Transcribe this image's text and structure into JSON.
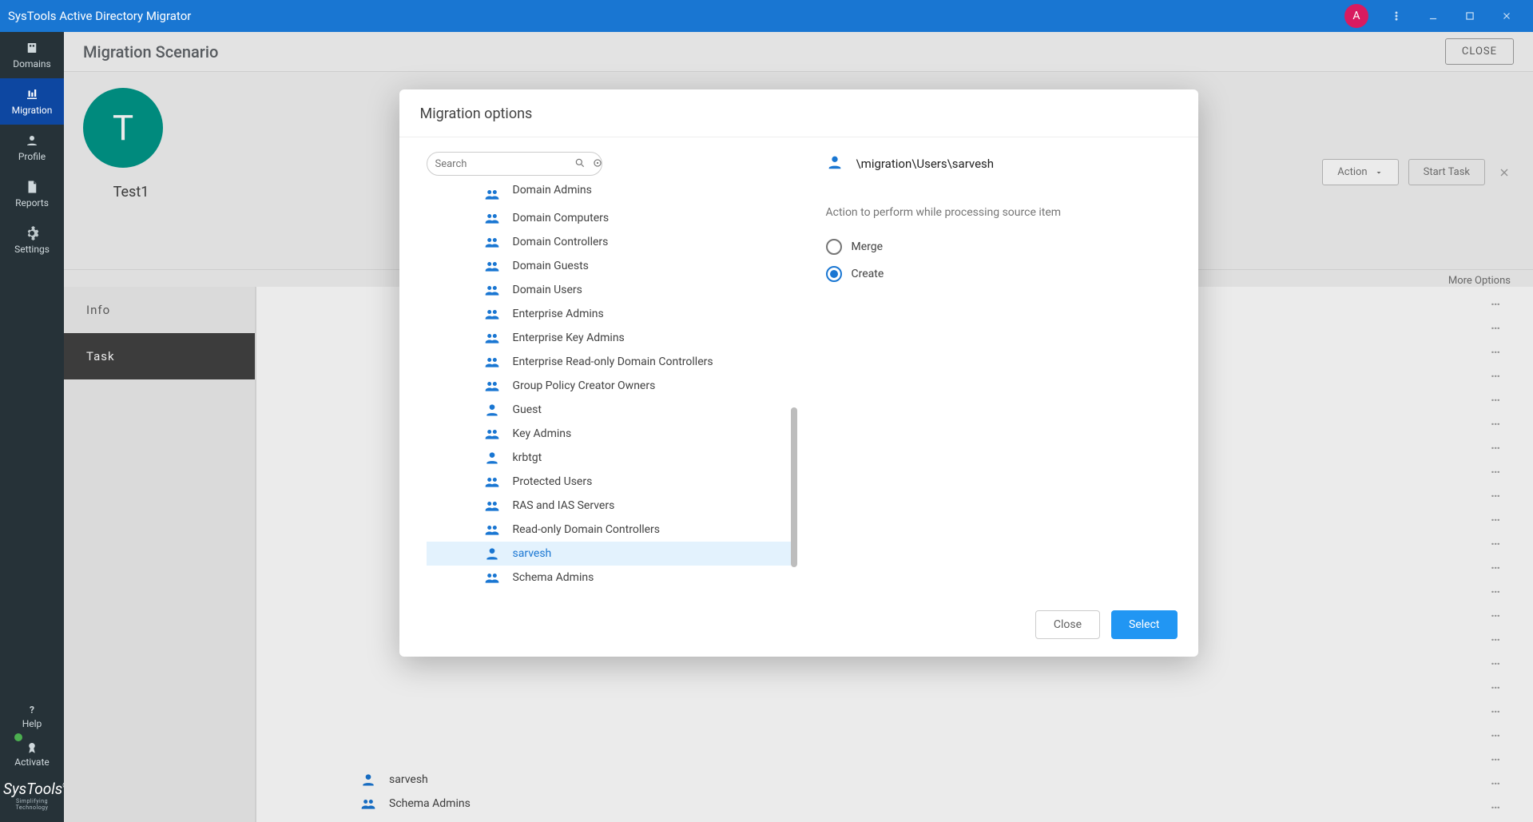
{
  "titlebar": {
    "title": "SysTools Active Directory Migrator",
    "avatar_letter": "A"
  },
  "sidebar": {
    "items": [
      {
        "label": "Domains"
      },
      {
        "label": "Migration"
      },
      {
        "label": "Profile"
      },
      {
        "label": "Reports"
      },
      {
        "label": "Settings"
      }
    ],
    "help": "Help",
    "activate": "Activate"
  },
  "brand": {
    "main": "SysTools",
    "reg": "®",
    "sub": "Simplifying Technology"
  },
  "scenario": {
    "header": "Migration Scenario",
    "close": "CLOSE",
    "avatar_letter": "T",
    "name": "Test1",
    "action_label": "Action",
    "start_label": "Start Task",
    "more_options": "More Options"
  },
  "tabs": [
    {
      "label": "Info"
    },
    {
      "label": "Task"
    }
  ],
  "bg_items": [
    {
      "type": "user",
      "label": "sarvesh"
    },
    {
      "type": "group",
      "label": "Schema Admins"
    }
  ],
  "modal": {
    "title": "Migration options",
    "search_placeholder": "Search",
    "entries": [
      {
        "type": "group",
        "label": "Domain Admins",
        "cut": true
      },
      {
        "type": "group",
        "label": "Domain Computers"
      },
      {
        "type": "group",
        "label": "Domain Controllers"
      },
      {
        "type": "group",
        "label": "Domain Guests"
      },
      {
        "type": "group",
        "label": "Domain Users"
      },
      {
        "type": "group",
        "label": "Enterprise Admins"
      },
      {
        "type": "group",
        "label": "Enterprise Key Admins"
      },
      {
        "type": "group",
        "label": "Enterprise Read-only Domain Controllers"
      },
      {
        "type": "group",
        "label": "Group Policy Creator Owners"
      },
      {
        "type": "user",
        "label": "Guest"
      },
      {
        "type": "group",
        "label": "Key Admins"
      },
      {
        "type": "user",
        "label": "krbtgt"
      },
      {
        "type": "group",
        "label": "Protected Users"
      },
      {
        "type": "group",
        "label": "RAS and IAS Servers"
      },
      {
        "type": "group",
        "label": "Read-only Domain Controllers"
      },
      {
        "type": "user",
        "label": "sarvesh",
        "selected": true
      },
      {
        "type": "group",
        "label": "Schema Admins"
      }
    ],
    "selected_path": "\\migration\\Users\\sarvesh",
    "action_question": "Action to perform while processing source item",
    "options": [
      {
        "label": "Merge",
        "checked": false
      },
      {
        "label": "Create",
        "checked": true
      }
    ],
    "close_btn": "Close",
    "select_btn": "Select"
  }
}
